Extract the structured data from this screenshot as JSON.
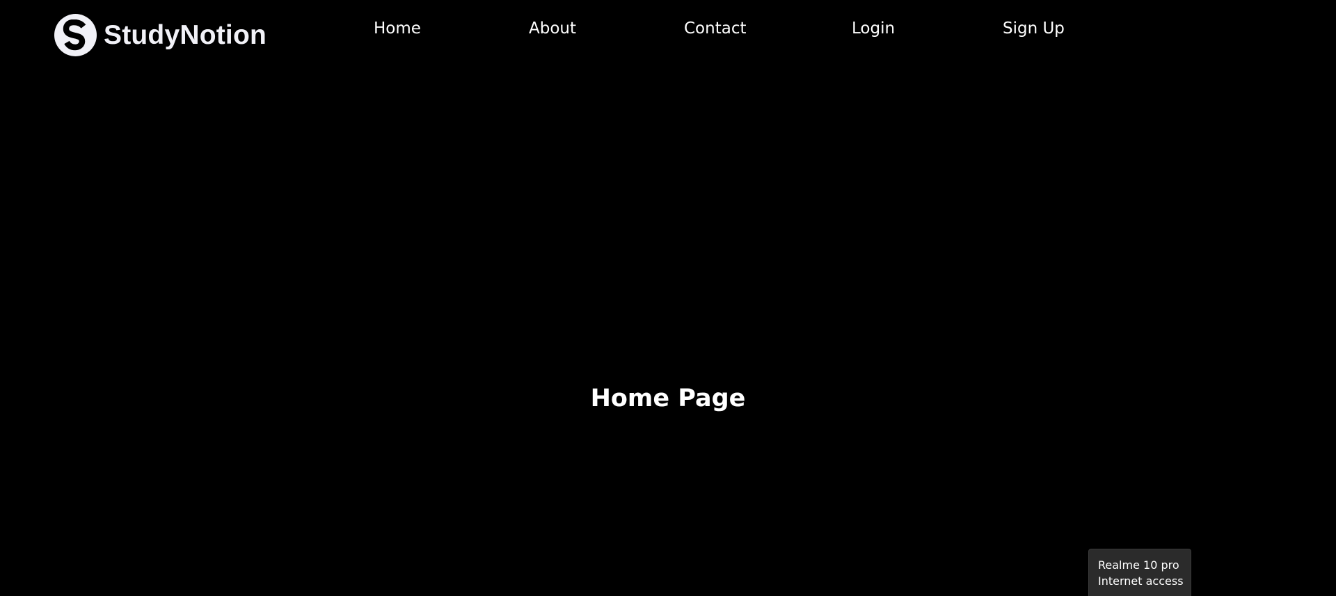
{
  "brand": {
    "name": "StudyNotion",
    "logo_icon": "letter-s-circle-icon"
  },
  "nav": {
    "items": [
      {
        "label": "Home"
      },
      {
        "label": "About"
      },
      {
        "label": "Contact"
      },
      {
        "label": "Login"
      },
      {
        "label": "Sign Up"
      }
    ]
  },
  "main": {
    "title": "Home Page"
  },
  "tooltip": {
    "line1": "Realme 10 pro",
    "line2": "Internet access"
  },
  "colors": {
    "background": "#000000",
    "text": "#ffffff",
    "logo": "#f1f1f7",
    "tooltip_bg": "#2b2b2b"
  }
}
